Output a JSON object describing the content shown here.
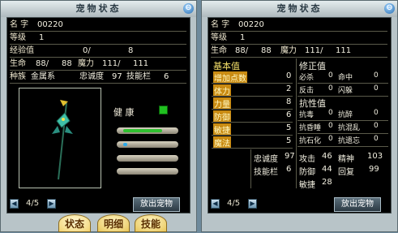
{
  "left": {
    "title": "宠物状态",
    "close_glyph": "⊖",
    "name_label": "名  字",
    "name_value": "00220",
    "level_label": "等级",
    "level_value": "1",
    "exp_label": "经验值",
    "exp_value": "0/",
    "exp_max": "8",
    "hp_label": "生命",
    "hp_value": "88/",
    "hp_max": "88",
    "mp_label": "魔力",
    "mp_value": "111/",
    "mp_max": "111",
    "race_label": "种族",
    "race_value": "金属系",
    "loyalty_label": "忠诚度",
    "loyalty_value": "97",
    "skills_label": "技能栏",
    "skills_value": "6",
    "health_label": "健 康",
    "health_color": "#20c020",
    "bars": [
      {
        "fill": 0.8,
        "color": "#30c030"
      },
      {
        "fill": 0.08,
        "color": "#2aa8e8"
      },
      {
        "fill": 0,
        "color": "#30c030"
      },
      {
        "fill": 0,
        "color": "#30c030"
      }
    ],
    "page": "4/5",
    "release_button": "放出宠物"
  },
  "right": {
    "title": "宠物状态",
    "close_glyph": "⊖",
    "name_label": "名  字",
    "name_value": "00220",
    "level_label": "等级",
    "level_value": "1",
    "hp_label": "生命",
    "hp_value": "88/",
    "hp_max": "88",
    "mp_label": "魔力",
    "mp_value": "111/",
    "mp_max": "111",
    "base_header": "基本值",
    "base_stats": [
      {
        "label": "增加点数",
        "value": "0"
      },
      {
        "label": "体力",
        "value": "2"
      },
      {
        "label": "力量",
        "value": "8"
      },
      {
        "label": "防御",
        "value": "6"
      },
      {
        "label": "敏捷",
        "value": "5"
      },
      {
        "label": "魔法",
        "value": "5"
      }
    ],
    "correction_header": "修正值",
    "correction_stats": [
      {
        "l1": "必杀",
        "v1": "0",
        "l2": "命中",
        "v2": "0"
      },
      {
        "l1": "反击",
        "v1": "0",
        "l2": "闪躲",
        "v2": "0"
      }
    ],
    "resist_header": "抗性值",
    "resist_stats": [
      {
        "l1": "抗毒",
        "v1": "0",
        "l2": "抗醉",
        "v2": "0"
      },
      {
        "l1": "抗昏睡",
        "v1": "0",
        "l2": "抗混乱",
        "v2": "0"
      },
      {
        "l1": "抗石化",
        "v1": "0",
        "l2": "抗遗忘",
        "v2": "0"
      }
    ],
    "loyalty_label": "忠诚度",
    "loyalty_value": "97",
    "skills_label": "技能栏",
    "skills_value": "6",
    "attack_label": "攻击",
    "attack_value": "46",
    "spirit_label": "精神",
    "spirit_value": "103",
    "defense_label": "防御",
    "defense_value": "44",
    "recover_label": "回复",
    "recover_value": "99",
    "agility_label": "敏捷",
    "agility_value": "28",
    "page": "4/5",
    "release_button": "放出宠物"
  },
  "tabs": [
    "状态",
    "明细",
    "技能"
  ]
}
